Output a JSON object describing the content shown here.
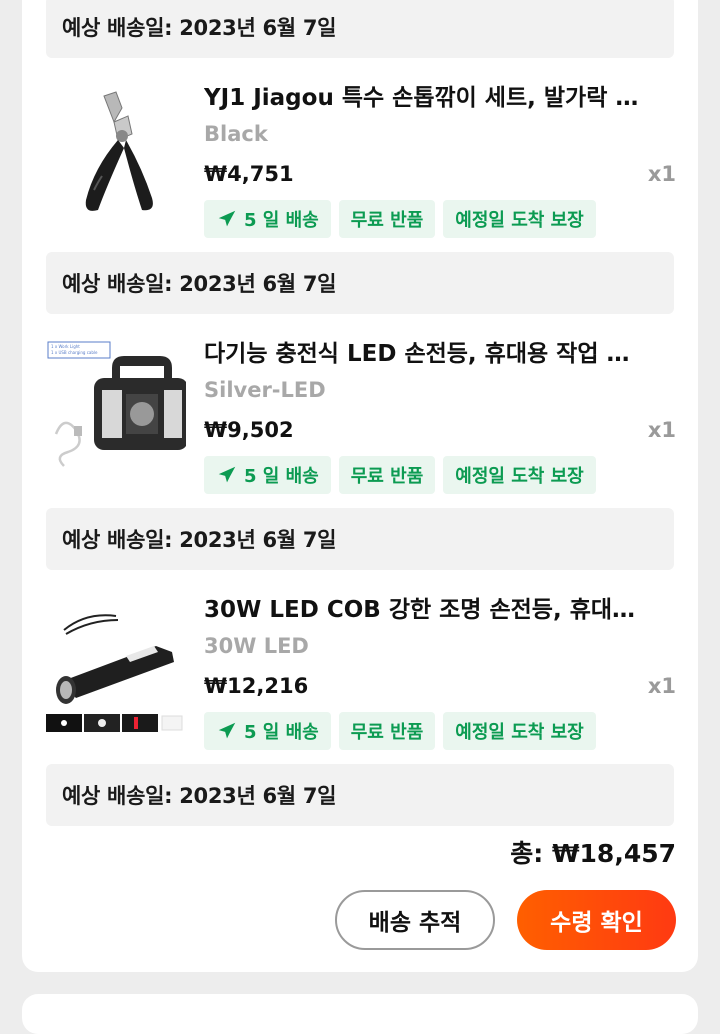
{
  "orders": [
    {
      "ship_date": "예상 배송일: 2023년 6월 7일",
      "title": "YJ1 Jiagou 특수 손톱깎이 세트, 발가락 …",
      "variant": "Black",
      "price": "₩4,751",
      "qty": "x1",
      "tags": [
        "5 일 배송",
        "무료 반품",
        "예정일 도착 보장"
      ],
      "image": "nail-clipper"
    },
    {
      "ship_date": "예상 배송일: 2023년 6월 7일",
      "title": "다기능 충전식 LED 손전등, 휴대용 작업 …",
      "variant": "Silver-LED",
      "price": "₩9,502",
      "qty": "x1",
      "tags": [
        "5 일 배송",
        "무료 반품",
        "예정일 도착 보장"
      ],
      "image": "work-lamp",
      "image_caption_1": "1 x Work Light",
      "image_caption_2": "1 x USB charging cable"
    },
    {
      "ship_date": "예상 배송일: 2023년 6월 7일",
      "title": "30W LED COB 강한 조명 손전등, 휴대…",
      "variant": "30W LED",
      "price": "₩12,216",
      "qty": "x1",
      "tags": [
        "5 일 배송",
        "무료 반품",
        "예정일 도착 보장"
      ],
      "image": "flashlight"
    },
    {
      "ship_date": "예상 배송일: 2023년 6월 7일"
    }
  ],
  "total": "총: ₩18,457",
  "buttons": {
    "track": "배송 추적",
    "confirm": "수령 확인"
  },
  "colors": {
    "accent": "#ff4a0a",
    "tag_green": "#0c9b52",
    "tag_bg": "#eaf6ef"
  }
}
